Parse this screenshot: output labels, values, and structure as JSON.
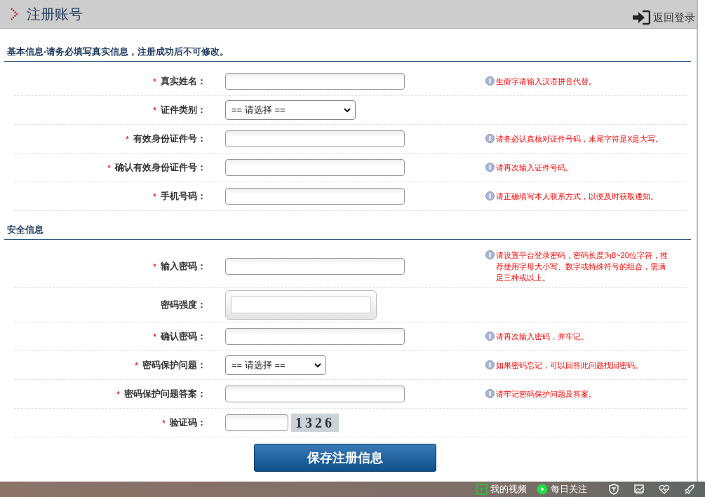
{
  "header": {
    "title": "注册账号",
    "back_link": "返回登录"
  },
  "sections": [
    {
      "title": "基本信息-请务必填写真实信息，注册成功后不可修改。",
      "rows": [
        {
          "mark": "*",
          "label": "真实姓名：",
          "kind": "text",
          "hint": "生僻字请输入汉语拼音代替。"
        },
        {
          "mark": "*",
          "label": "证件类别：",
          "kind": "select",
          "value": "== 请选择 =="
        },
        {
          "mark": "*",
          "label": "有效身份证件号：",
          "kind": "text",
          "hint": "请务必认真核对证件号码，末尾字符是X是大写。"
        },
        {
          "mark": "*",
          "label": "确认有效身份证件号：",
          "kind": "text",
          "hint": "请再次输入证件号码。"
        },
        {
          "mark": "*",
          "label": "手机号码：",
          "kind": "text",
          "hint": "请正确填写本人联系方式，以便及时获取通知。"
        }
      ]
    },
    {
      "title": "安全信息",
      "rows": [
        {
          "mark": "*",
          "label": "输入密码：",
          "kind": "text",
          "hint": "请设置平台登录密码，密码长度为8~20位字符，推荐使用字母大小写、数字或特殊符号的组合，需满足三种或以上。"
        },
        {
          "label": "密码强度：",
          "kind": "strength"
        },
        {
          "mark": "*",
          "label": "确认密码：",
          "kind": "text",
          "hint": "请再次输入密码，并牢记。"
        },
        {
          "mark": "*",
          "label": "密码保护问题：",
          "kind": "select",
          "value": "== 请选择 ==",
          "hint": "如果密码忘记，可以回答此问题找回密码。"
        },
        {
          "mark": "*",
          "label": "密码保护问题答案：",
          "kind": "text",
          "hint": "请牢记密码保护问题及答案。"
        },
        {
          "mark": "*",
          "label": "验证码：",
          "kind": "captcha",
          "code": "1326"
        }
      ]
    }
  ],
  "submit": "保存注册信息",
  "taskbar": {
    "items": [
      {
        "kind": "video",
        "label": "我的视频"
      },
      {
        "kind": "play",
        "label": "每日关注"
      }
    ],
    "icons": [
      {
        "kind": "shield"
      },
      {
        "kind": "image"
      },
      {
        "kind": "heart"
      },
      {
        "kind": "rocket"
      }
    ]
  }
}
